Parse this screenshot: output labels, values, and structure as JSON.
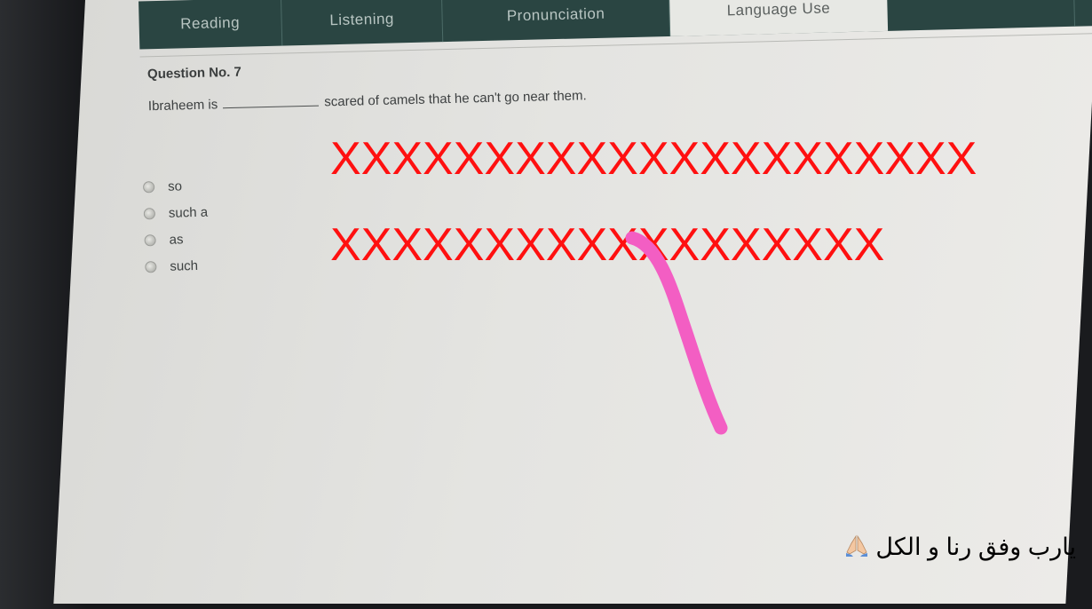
{
  "tabs": [
    {
      "label": "Reading",
      "active": false
    },
    {
      "label": "Listening",
      "active": false
    },
    {
      "label": "Pronunciation",
      "active": false
    },
    {
      "label": "Language Use",
      "active": true
    },
    {
      "label": "",
      "active": false
    }
  ],
  "question": {
    "title": "Question No. 7",
    "text_before": "Ibraheem is",
    "text_after": "scared of camels that he can't go near them.",
    "options": [
      "so",
      "such a",
      "as",
      "such"
    ]
  },
  "overlay": {
    "x_row_1": "XXXXXXXXXXXXXXXXXXXXX",
    "x_row_2": "XXXXXXXXXXXXXXXXXX",
    "x_color": "#ff1010",
    "stroke_color": "#f35ec3",
    "caption": "يارب وفق رنا و الكل",
    "caption_emoji": "folded-hands-icon"
  },
  "colors": {
    "tabbar": "#2a4542",
    "screen": "#e4e4e1"
  }
}
